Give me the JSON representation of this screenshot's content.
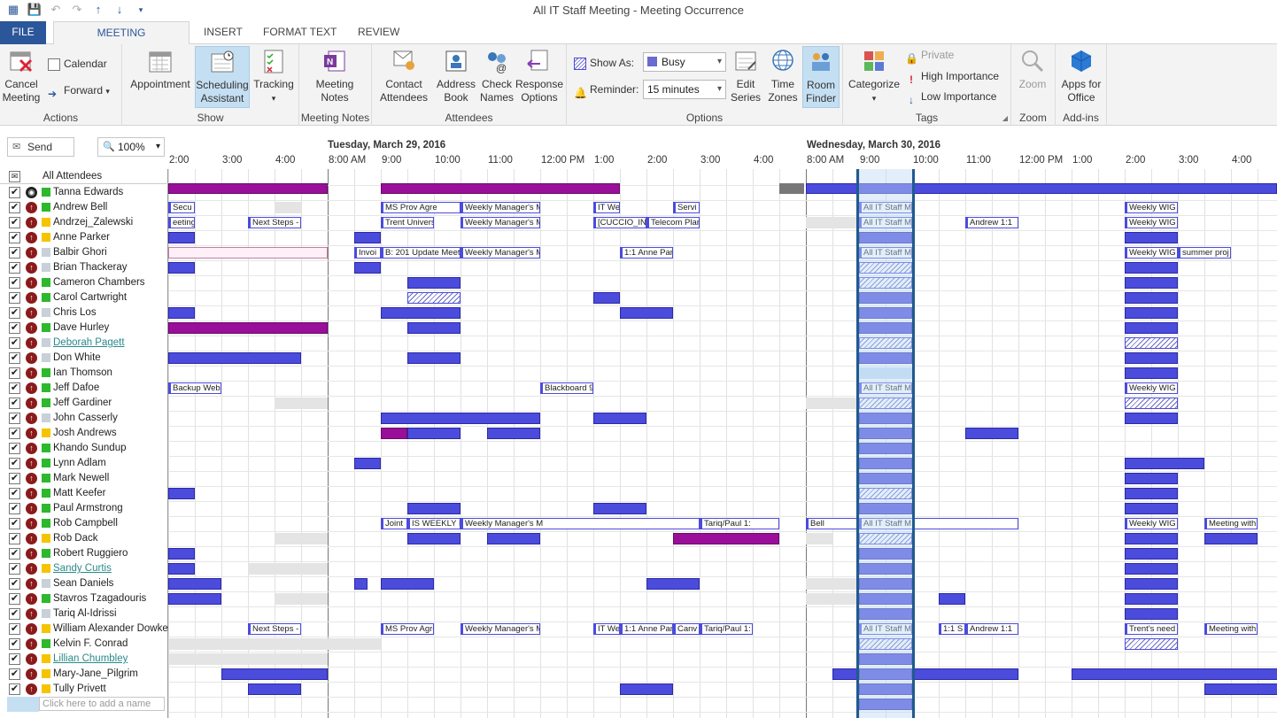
{
  "window": {
    "title": "All IT Staff Meeting - Meeting Occurrence"
  },
  "tabs": [
    "FILE",
    "MEETING OCCURRENCE",
    "INSERT",
    "FORMAT TEXT",
    "REVIEW"
  ],
  "ribbon": {
    "actions": {
      "label": "Actions",
      "cancel": "Cancel\nMeeting",
      "calendar": "Calendar",
      "forward": "Forward"
    },
    "show": {
      "label": "Show",
      "appointment": "Appointment",
      "scheduling": "Scheduling\nAssistant",
      "tracking": "Tracking"
    },
    "meeting_notes": {
      "label": "Meeting Notes",
      "btn": "Meeting\nNotes"
    },
    "attendees": {
      "label": "Attendees",
      "contact": "Contact\nAttendees",
      "address": "Address\nBook",
      "check": "Check\nNames",
      "response": "Response\nOptions"
    },
    "options": {
      "label": "Options",
      "show_as_label": "Show As:",
      "show_as_value": "Busy",
      "reminder_label": "Reminder:",
      "reminder_value": "15 minutes",
      "edit_series": "Edit\nSeries",
      "time_zones": "Time\nZones",
      "room_finder": "Room\nFinder"
    },
    "tags": {
      "label": "Tags",
      "categorize": "Categorize",
      "private": "Private",
      "high": "High Importance",
      "low": "Low Importance"
    },
    "zoom": {
      "label": "Zoom",
      "btn": "Zoom"
    },
    "addins": {
      "label": "Add-ins",
      "btn": "Apps for\nOffice"
    }
  },
  "toolbar": {
    "send": "Send",
    "zoom": "100%"
  },
  "grid": {
    "day1": "Tuesday, March 29, 2016",
    "day2": "Wednesday, March 30, 2016",
    "times_prev": [
      "2:00",
      "3:00",
      "4:00"
    ],
    "times_day1": [
      "8:00 AM",
      "9:00",
      "10:00",
      "11:00",
      "12:00 PM",
      "1:00",
      "2:00",
      "3:00",
      "4:00"
    ],
    "times_day2": [
      "8:00 AM",
      "9:00",
      "10:00",
      "11:00",
      "12:00 PM",
      "1:00",
      "2:00",
      "3:00",
      "4:00"
    ]
  },
  "attendees_header": "All Attendees",
  "add_name_placeholder": "Click here to add a name",
  "attendees": [
    {
      "name": "Tanna Edwards",
      "status": "#2db82d",
      "role": "org",
      "link": false
    },
    {
      "name": "Andrew Bell",
      "status": "#2db82d",
      "role": "req",
      "link": false
    },
    {
      "name": "Andrzej_Zalewski",
      "status": "#f5c400",
      "role": "req",
      "link": false
    },
    {
      "name": "Anne Parker",
      "status": "#f5c400",
      "role": "req",
      "link": false
    },
    {
      "name": "Balbir Ghori",
      "status": "#c8d0d8",
      "role": "req",
      "link": false
    },
    {
      "name": "Brian Thackeray",
      "status": "#c8d0d8",
      "role": "req",
      "link": false
    },
    {
      "name": "Cameron Chambers",
      "status": "#2db82d",
      "role": "req",
      "link": false
    },
    {
      "name": "Carol Cartwright",
      "status": "#2db82d",
      "role": "req",
      "link": false
    },
    {
      "name": "Chris Los",
      "status": "#c8d0d8",
      "role": "req",
      "link": false
    },
    {
      "name": "Dave Hurley",
      "status": "#2db82d",
      "role": "req",
      "link": false
    },
    {
      "name": "Deborah Pagett",
      "status": "#c8d0d8",
      "role": "req",
      "link": true
    },
    {
      "name": "Don White",
      "status": "#c8d0d8",
      "role": "req",
      "link": false
    },
    {
      "name": "Ian Thomson",
      "status": "#2db82d",
      "role": "req",
      "link": false
    },
    {
      "name": "Jeff Dafoe",
      "status": "#2db82d",
      "role": "req",
      "link": false
    },
    {
      "name": "Jeff Gardiner",
      "status": "#2db82d",
      "role": "req",
      "link": false
    },
    {
      "name": "John Casserly",
      "status": "#c8d0d8",
      "role": "req",
      "link": false
    },
    {
      "name": "Josh Andrews",
      "status": "#f5c400",
      "role": "req",
      "link": false
    },
    {
      "name": "Khando Sundup",
      "status": "#2db82d",
      "role": "req",
      "link": false
    },
    {
      "name": "Lynn Adlam",
      "status": "#2db82d",
      "role": "req",
      "link": false
    },
    {
      "name": "Mark Newell",
      "status": "#2db82d",
      "role": "req",
      "link": false
    },
    {
      "name": "Matt Keefer",
      "status": "#2db82d",
      "role": "req",
      "link": false
    },
    {
      "name": "Paul Armstrong",
      "status": "#2db82d",
      "role": "req",
      "link": false
    },
    {
      "name": "Rob Campbell",
      "status": "#2db82d",
      "role": "req",
      "link": false
    },
    {
      "name": "Rob Dack",
      "status": "#f5c400",
      "role": "req",
      "link": false
    },
    {
      "name": "Robert Ruggiero",
      "status": "#2db82d",
      "role": "req",
      "link": false
    },
    {
      "name": "Sandy Curtis",
      "status": "#f5c400",
      "role": "req",
      "link": true
    },
    {
      "name": "Sean Daniels",
      "status": "#c8d0d8",
      "role": "req",
      "link": false
    },
    {
      "name": "Stavros Tzagadouris",
      "status": "#2db82d",
      "role": "req",
      "link": false
    },
    {
      "name": "Tariq Al-Idrissi",
      "status": "#c8d0d8",
      "role": "req",
      "link": false
    },
    {
      "name": "William Alexander Dowkes",
      "status": "#f5c400",
      "role": "req",
      "link": false
    },
    {
      "name": "Kelvin F. Conrad",
      "status": "#2db82d",
      "role": "req",
      "link": false
    },
    {
      "name": "Lillian Chumbley",
      "status": "#f5c400",
      "role": "req",
      "link": true
    },
    {
      "name": "Mary-Jane_Pilgrim",
      "status": "#f5c400",
      "role": "req",
      "link": false
    },
    {
      "name": "Tully Privett",
      "status": "#f5c400",
      "role": "req",
      "link": false
    }
  ],
  "events": [
    {
      "row": 0,
      "start": 14.0,
      "end": 14.5,
      "type": "lbl",
      "text": "Secu"
    },
    {
      "row": 0,
      "start": 33.0,
      "end": 34.5,
      "type": "lbl",
      "text": "MS Prov Agre"
    },
    {
      "row": 0,
      "start": 34.5,
      "end": 36.0,
      "type": "lbl",
      "text": "Weekly Manager's M"
    },
    {
      "row": 0,
      "start": 37.0,
      "end": 37.5,
      "type": "lbl",
      "text": "IT We"
    },
    {
      "row": 0,
      "start": 38.5,
      "end": 39.0,
      "type": "lbl",
      "text": "Servi"
    },
    {
      "row": 0,
      "start": 57.0,
      "end": 58.0,
      "type": "lbl",
      "text": "All IT Staff M"
    },
    {
      "row": 0,
      "start": 62.0,
      "end": 63.0,
      "type": "lbl",
      "text": "Weekly WIG M"
    },
    {
      "row": 1,
      "start": 14.0,
      "end": 14.5,
      "type": "lbl",
      "text": "eeting"
    },
    {
      "row": 1,
      "start": 15.5,
      "end": 16.5,
      "type": "lbl",
      "text": "Next Steps -"
    },
    {
      "row": 1,
      "start": 33.0,
      "end": 34.0,
      "type": "lbl",
      "text": "Trent Univers"
    },
    {
      "row": 1,
      "start": 34.5,
      "end": 36.0,
      "type": "lbl",
      "text": "Weekly Manager's M"
    },
    {
      "row": 1,
      "start": 37.0,
      "end": 38.0,
      "type": "lbl",
      "text": "[CUCCIO_IN"
    },
    {
      "row": 1,
      "start": 38.0,
      "end": 39.0,
      "type": "lbl",
      "text": "Telecom Plan"
    },
    {
      "row": 1,
      "start": 57.0,
      "end": 58.0,
      "type": "lbl",
      "text": "All IT Staff M"
    },
    {
      "row": 1,
      "start": 59.0,
      "end": 60.0,
      "type": "lbl",
      "text": "Andrew 1:1"
    },
    {
      "row": 1,
      "start": 62.0,
      "end": 63.0,
      "type": "lbl",
      "text": "Weekly WIG M"
    },
    {
      "row": 3,
      "start": 32.5,
      "end": 33.0,
      "type": "lbl",
      "text": "Invoi"
    },
    {
      "row": 3,
      "start": 33.0,
      "end": 34.5,
      "type": "lbl",
      "text": "B: 201 Update Meeti"
    },
    {
      "row": 3,
      "start": 34.5,
      "end": 36.0,
      "type": "lbl",
      "text": "Weekly Manager's M"
    },
    {
      "row": 3,
      "start": 37.5,
      "end": 38.5,
      "type": "lbl",
      "text": "1:1 Anne Par"
    },
    {
      "row": 3,
      "start": 57.0,
      "end": 58.0,
      "type": "lbl",
      "text": "All IT Staff M"
    },
    {
      "row": 3,
      "start": 62.0,
      "end": 63.0,
      "type": "lbl",
      "text": "Weekly WIG M"
    },
    {
      "row": 3,
      "start": 63.0,
      "end": 64.0,
      "type": "lbl",
      "text": "summer proj"
    },
    {
      "row": 12,
      "start": 14.0,
      "end": 15.0,
      "type": "lbl",
      "text": "Backup Webi"
    },
    {
      "row": 12,
      "start": 36.0,
      "end": 37.0,
      "type": "lbl",
      "text": "Blackboard 9"
    },
    {
      "row": 12,
      "start": 57.0,
      "end": 58.0,
      "type": "lbl",
      "text": "All IT Staff M"
    },
    {
      "row": 12,
      "start": 62.0,
      "end": 63.0,
      "type": "lbl",
      "text": "Weekly WIG M"
    },
    {
      "row": 21,
      "start": 33.0,
      "end": 33.5,
      "type": "lbl",
      "text": "Joint"
    },
    {
      "row": 21,
      "start": 33.5,
      "end": 34.5,
      "type": "lbl",
      "text": "IS WEEKLY M"
    },
    {
      "row": 21,
      "start": 34.5,
      "end": 39.0,
      "type": "lbl",
      "text": "Weekly Manager's M"
    },
    {
      "row": 21,
      "start": 39.0,
      "end": 40.5,
      "type": "lbl",
      "text": "Tariq/Paul 1:"
    },
    {
      "row": 21,
      "start": 56.0,
      "end": 57.0,
      "type": "lbl",
      "text": "Bell"
    },
    {
      "row": 21,
      "start": 57.0,
      "end": 60.0,
      "type": "lbl",
      "text": "All IT Staff M"
    },
    {
      "row": 21,
      "start": 62.0,
      "end": 63.0,
      "type": "lbl",
      "text": "Weekly WIG M"
    },
    {
      "row": 21,
      "start": 63.5,
      "end": 64.5,
      "type": "lbl",
      "text": "Meeting with"
    },
    {
      "row": 28,
      "start": 15.5,
      "end": 16.5,
      "type": "lbl",
      "text": "Next Steps -"
    },
    {
      "row": 28,
      "start": 33.0,
      "end": 34.0,
      "type": "lbl",
      "text": "MS Prov Agre"
    },
    {
      "row": 28,
      "start": 34.5,
      "end": 36.0,
      "type": "lbl",
      "text": "Weekly Manager's M"
    },
    {
      "row": 28,
      "start": 37.0,
      "end": 37.5,
      "type": "lbl",
      "text": "IT We"
    },
    {
      "row": 28,
      "start": 37.5,
      "end": 38.5,
      "type": "lbl",
      "text": "1:1 Anne Par"
    },
    {
      "row": 28,
      "start": 38.5,
      "end": 39.0,
      "type": "lbl",
      "text": "Canv"
    },
    {
      "row": 28,
      "start": 39.0,
      "end": 40.0,
      "type": "lbl",
      "text": "Tariq/Paul 1:"
    },
    {
      "row": 28,
      "start": 57.0,
      "end": 58.0,
      "type": "lbl",
      "text": "All IT Staff M"
    },
    {
      "row": 28,
      "start": 58.5,
      "end": 59.0,
      "type": "lbl",
      "text": "1:1 S"
    },
    {
      "row": 28,
      "start": 59.0,
      "end": 60.0,
      "type": "lbl",
      "text": "Andrew 1:1"
    },
    {
      "row": 28,
      "start": 62.0,
      "end": 63.0,
      "type": "lbl",
      "text": "Trent's need"
    },
    {
      "row": 28,
      "start": 63.5,
      "end": 64.5,
      "type": "lbl",
      "text": "Meeting with"
    }
  ]
}
